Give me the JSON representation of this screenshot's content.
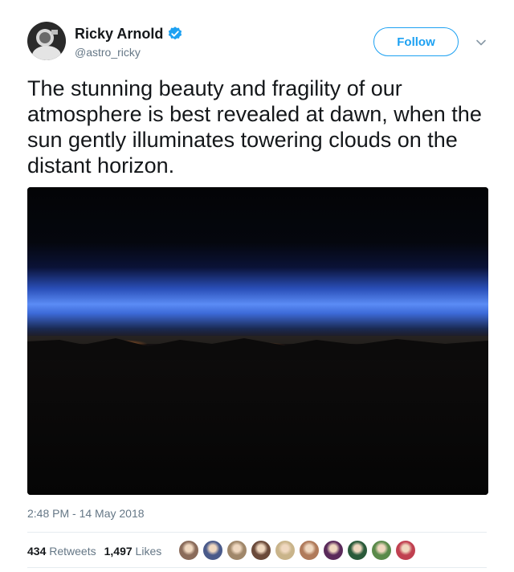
{
  "user": {
    "display_name": "Ricky Arnold",
    "handle": "@astro_ricky",
    "verified_icon": "verified-badge-icon",
    "accent_color": "#1da1f2"
  },
  "actions": {
    "follow_label": "Follow",
    "more_icon": "chevron-down-icon"
  },
  "tweet": {
    "text": "The stunning beauty and fragility of our atmosphere is best revealed at dawn, when the sun gently illuminates towering clouds on the distant horizon.",
    "media_description_icon": "photo-earth-horizon",
    "timestamp": "2:48 PM - 14 May 2018"
  },
  "stats": {
    "retweets_count": "434",
    "retweets_label": "Retweets",
    "likes_count": "1,497",
    "likes_label": "Likes"
  },
  "likers": [
    {
      "color": "#8a6b5a"
    },
    {
      "color": "#4a5a8a"
    },
    {
      "color": "#a0876a"
    },
    {
      "color": "#6b4a3a"
    },
    {
      "color": "#c9b48a"
    },
    {
      "color": "#b07a5a"
    },
    {
      "color": "#5a2a5a"
    },
    {
      "color": "#2a5a3a"
    },
    {
      "color": "#5a8a4a"
    },
    {
      "color": "#c04050"
    }
  ]
}
